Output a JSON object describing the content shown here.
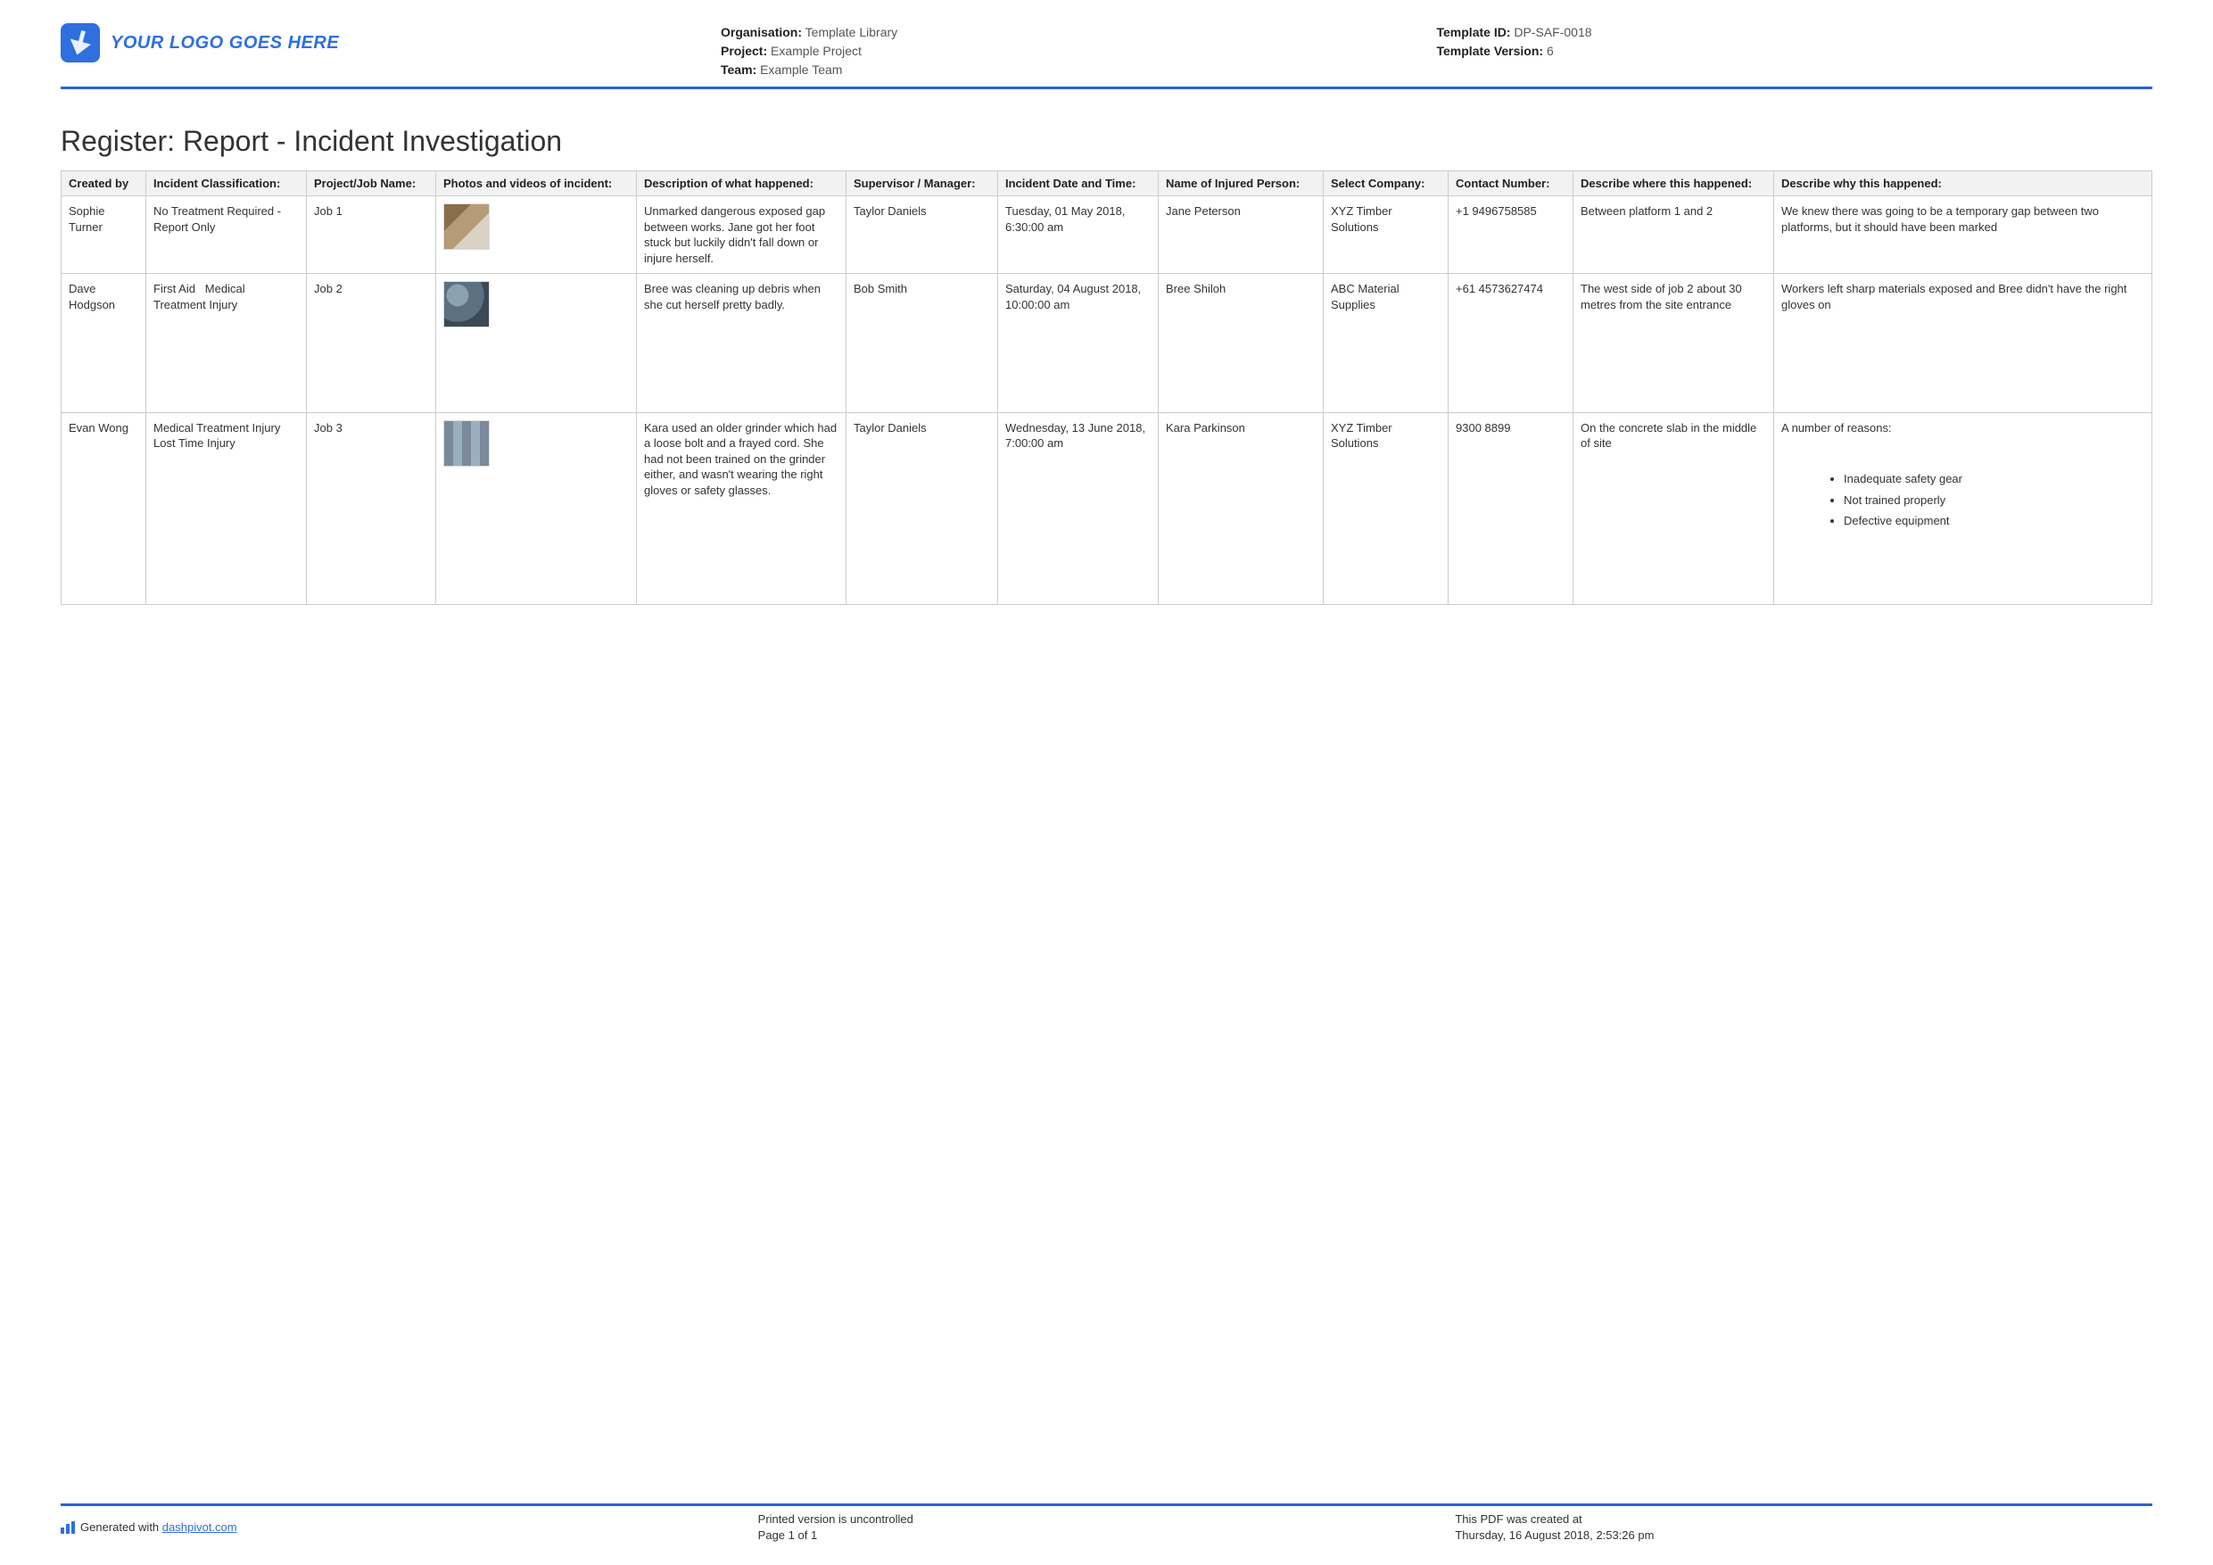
{
  "header": {
    "logo_text": "YOUR LOGO GOES HERE",
    "organisation_label": "Organisation:",
    "organisation_value": "Template Library",
    "project_label": "Project:",
    "project_value": "Example Project",
    "team_label": "Team:",
    "team_value": "Example Team",
    "template_id_label": "Template ID:",
    "template_id_value": "DP-SAF-0018",
    "template_version_label": "Template Version:",
    "template_version_value": "6"
  },
  "title": "Register: Report - Incident Investigation",
  "columns": {
    "created_by": "Created by",
    "classification": "Incident Classification:",
    "job": "Project/Job Name:",
    "photos": "Photos and videos of incident:",
    "description": "Description of what happened:",
    "supervisor": "Supervisor / Manager:",
    "datetime": "Incident Date and Time:",
    "injured": "Name of Injured Person:",
    "company": "Select Company:",
    "contact": "Contact Number:",
    "where": "Describe where this happened:",
    "why": "Describe why this happened:"
  },
  "rows": [
    {
      "created_by": "Sophie Turner",
      "classification": "No Treatment Required - Report Only",
      "job": "Job 1",
      "description": "Unmarked dangerous exposed gap between works. Jane got her foot stuck but luckily didn't fall down or injure herself.",
      "supervisor": "Taylor Daniels",
      "datetime": "Tuesday, 01 May 2018, 6:30:00 am",
      "injured": "Jane Peterson",
      "company": "XYZ Timber Solutions",
      "contact": "+1 9496758585",
      "where": "Between platform 1 and 2",
      "why": "We knew there was going to be a temporary gap between two platforms, but it should have been marked"
    },
    {
      "created_by": "Dave Hodgson",
      "classification": "First Aid   Medical Treatment Injury",
      "job": "Job 2",
      "description": "Bree was cleaning up debris when she cut herself pretty badly.",
      "supervisor": "Bob Smith",
      "datetime": "Saturday, 04 August 2018, 10:00:00 am",
      "injured": "Bree Shiloh",
      "company": "ABC Material Supplies",
      "contact": "+61 4573627474",
      "where": "The west side of job 2 about 30 metres from the site entrance",
      "why": "Workers left sharp materials exposed and Bree didn't have the right gloves on"
    },
    {
      "created_by": "Evan Wong",
      "classification": "Medical Treatment Injury   Lost Time Injury",
      "job": "Job 3",
      "description": "Kara used an older grinder which had a loose bolt and a frayed cord. She had not been trained on the grinder either, and wasn't wearing the right gloves or safety glasses.",
      "supervisor": "Taylor Daniels",
      "datetime": "Wednesday, 13 June 2018, 7:00:00 am",
      "injured": "Kara Parkinson",
      "company": "XYZ Timber Solutions",
      "contact": "9300 8899",
      "where": "On the concrete slab in the middle of site",
      "why_intro": "A number of reasons:",
      "why_list": [
        "Inadequate safety gear",
        "Not trained properly",
        "Defective equipment"
      ]
    }
  ],
  "footer": {
    "generated_prefix": "Generated with ",
    "generated_link": "dashpivot.com",
    "uncontrolled": "Printed version is uncontrolled",
    "page": "Page 1 of 1",
    "created_label": "This PDF was created at",
    "created_value": "Thursday, 16 August 2018, 2:53:26 pm"
  }
}
